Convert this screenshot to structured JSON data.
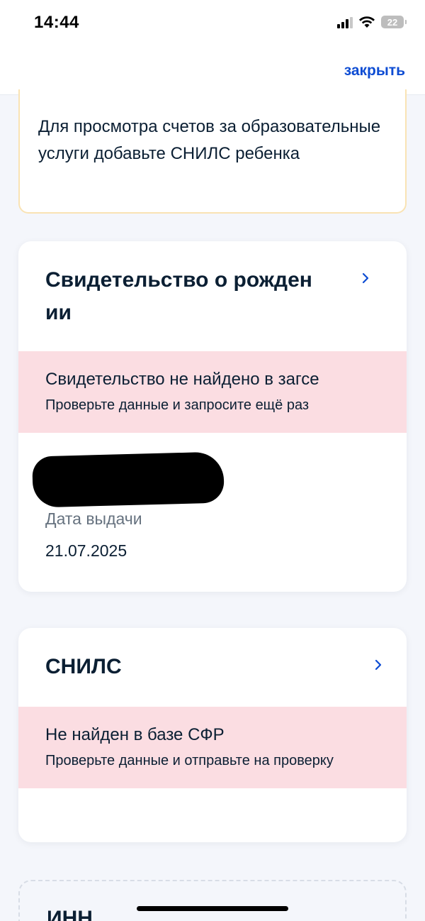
{
  "status_bar": {
    "time": "14:44",
    "battery": "22"
  },
  "nav": {
    "close_label": "закрыть"
  },
  "notice": {
    "text": "Для просмотра счетов за образовательные услуги добавьте СНИЛС ребенка"
  },
  "birth_certificate": {
    "title": "Свидетельство о рожден ии",
    "error_title": "Свидетельство не найдено в загсе",
    "error_hint": "Проверьте данные и запросите ещё раз",
    "issue_date_label": "Дата выдачи",
    "issue_date_value": "21.07.2025"
  },
  "snils": {
    "title": "СНИЛС",
    "error_title": "Не найден в базе СФР",
    "error_hint": "Проверьте данные и отправьте на проверку"
  },
  "inn": {
    "title": "ИНН"
  },
  "colors": {
    "accent": "#0d4cd3",
    "error_bg": "#fbdde2",
    "warning_border": "#f9e3b4",
    "page_bg": "#f4f6fb"
  },
  "icons": [
    "signal-icon",
    "wifi-icon",
    "battery-icon",
    "chevron-right-icon"
  ]
}
